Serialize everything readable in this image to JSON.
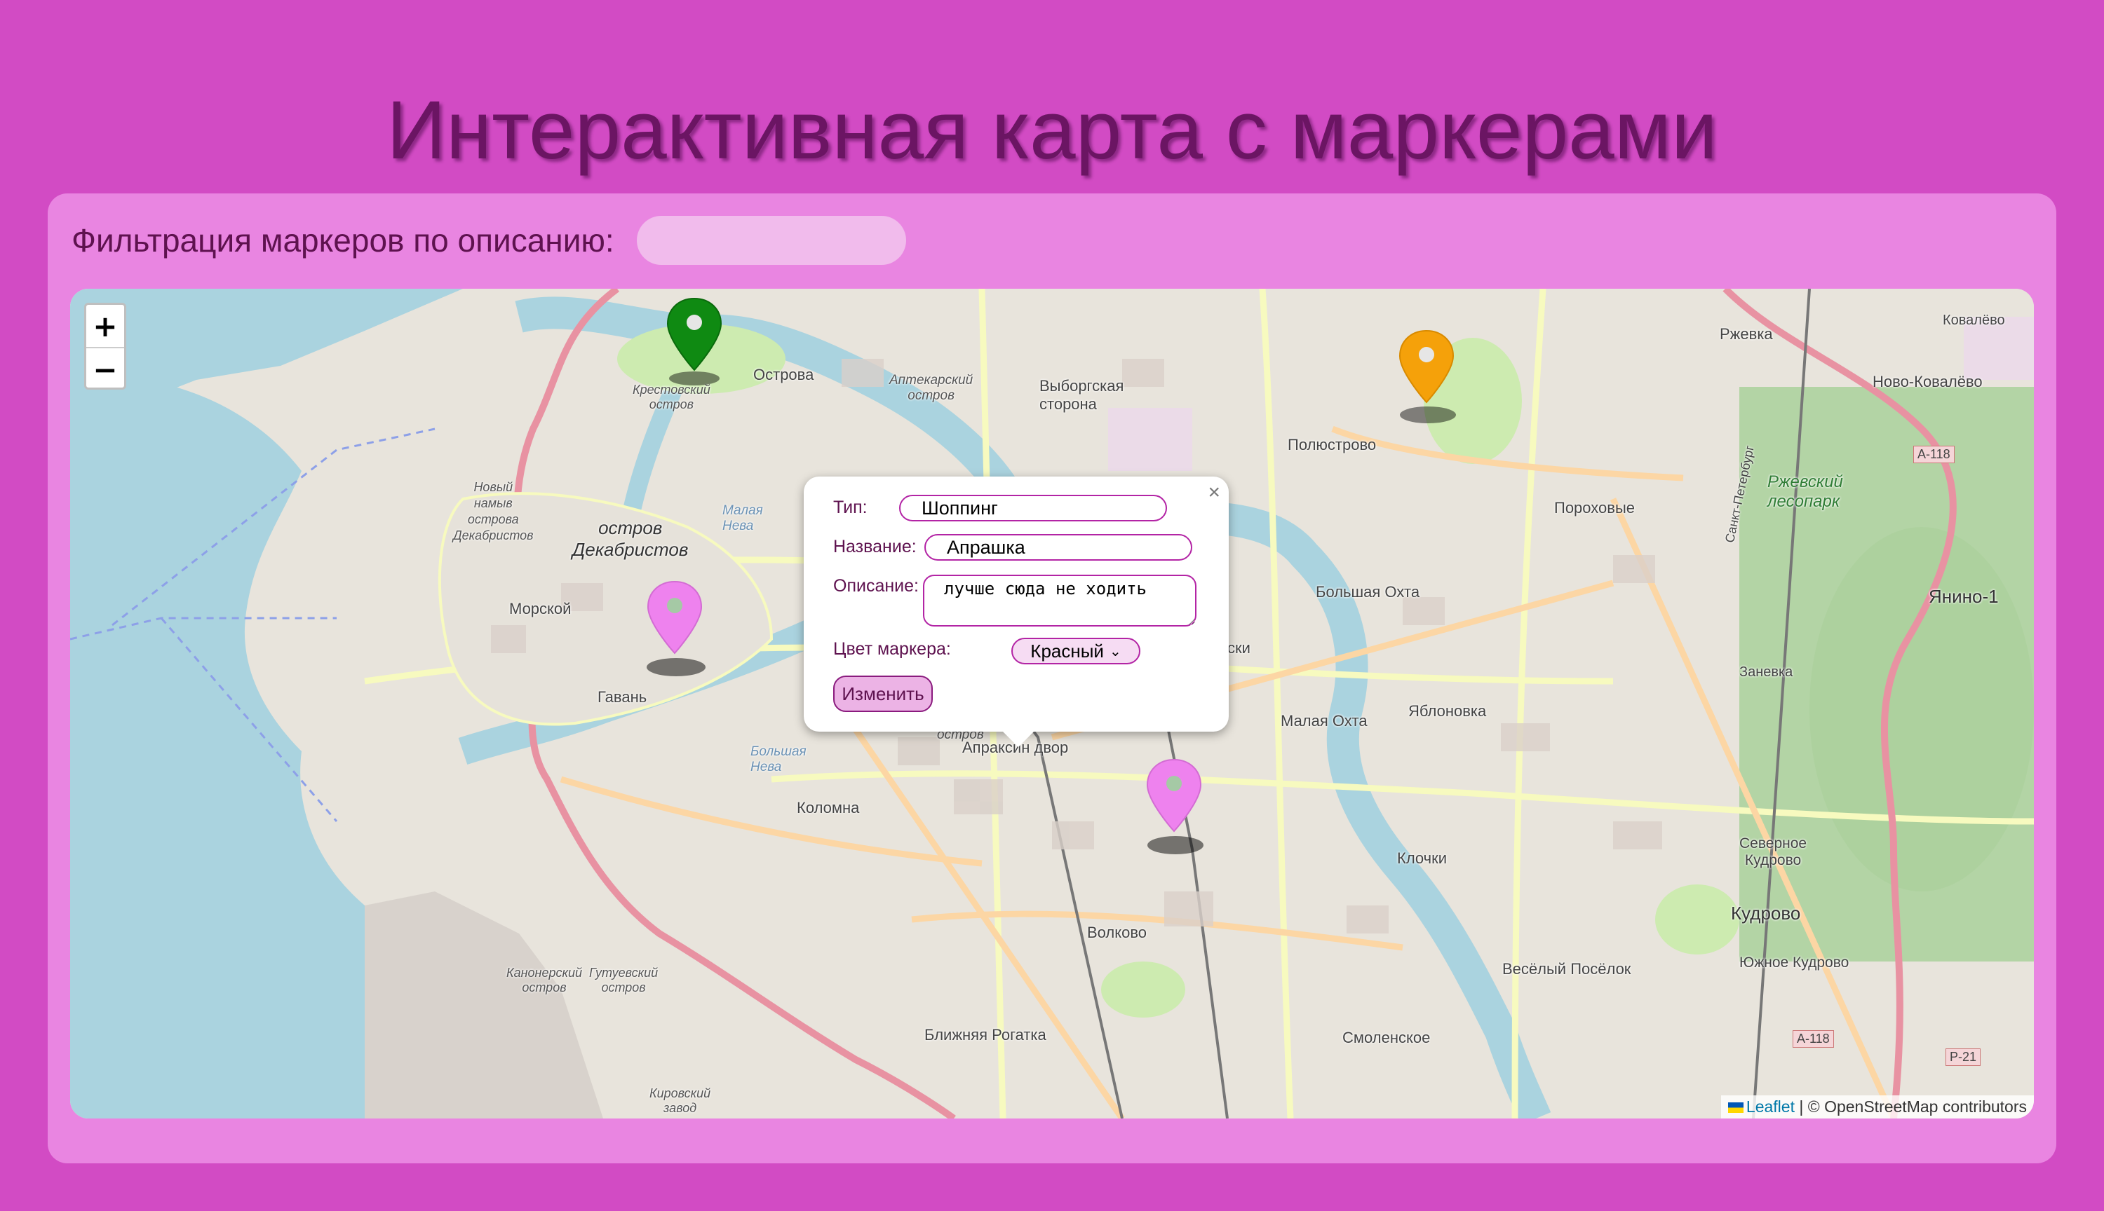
{
  "page": {
    "title": "Интерактивная карта с маркерами"
  },
  "filter": {
    "label": "Фильтрация маркеров по описанию:",
    "value": "",
    "placeholder": ""
  },
  "map": {
    "zoom_in": "+",
    "zoom_out": "−",
    "attribution": {
      "leaflet": "Leaflet",
      "separator": " | ",
      "osm": "© OpenStreetMap contributors"
    },
    "labels": {
      "krestovsky": "Крестовский\nостров",
      "ostrova": "Острова",
      "aptekarsky": "Аптекарский\nостров",
      "vyborgskaya": "Выборгская\nсторона",
      "polyustrovo": "Полюстрово",
      "rzhevka": "Ржевка",
      "kovalevo": "Ковалёво",
      "novo_kovalevo": "Ново-Ковалёво",
      "novye_ostrova": "Новый\nнамыв\nострова\nДекабристов",
      "dekabristov": "остров\nДекабристов",
      "malaya_neva": "Малая\nНева",
      "morskoy": "Морской",
      "gavan": "Гавань",
      "porokhovye": "Пороховые",
      "rzhevsky_lesopark": "Ржевский\nлесопарк",
      "bolshaya_okhta": "Большая Охта",
      "yanino": "Янино-1",
      "zanevka": "Заневка",
      "malaya_okhta": "Малая Охта",
      "yablonovka": "Яблоновка",
      "apraksin": "Апраксин двор",
      "ostrov": "остров",
      "bolshaya_neva": "Большая\nНева",
      "kolomna": "Коломна",
      "klochki": "Клочки",
      "severnoe_kudrovo": "Северное\nКудрово",
      "kudrovo": "Кудрово",
      "yuzhnoe_kudrovo": "Южное Кудрово",
      "volkovo": "Волково",
      "vesyoly": "Весёлый Посёлок",
      "kanonersky": "Канонерский\nостров",
      "gutuevsky": "Гутуевский\nостров",
      "blizhnyaya": "Ближняя Рогатка",
      "smolenskoe": "Смоленское",
      "kirovsky": "Кировский\nзавод",
      "a118_top": "А-118",
      "a118_bottom": "А-118",
      "r21": "Р-21",
      "skaya": "ски",
      "spb_ring": "Санкт-Петербург"
    },
    "markers": [
      {
        "name": "green",
        "color": "#0f8a12"
      },
      {
        "name": "orange",
        "color": "#f5a10a"
      },
      {
        "name": "violet-west",
        "color": "#ee82ee"
      },
      {
        "name": "violet-center",
        "color": "#ee82ee"
      }
    ]
  },
  "popup": {
    "close": "×",
    "type_label": "Тип:",
    "type_value": "Шоппинг",
    "name_label": "Название:",
    "name_value": "Апрашка",
    "desc_label": "Описание:",
    "desc_value": "лучше сюда не ходить",
    "color_label": "Цвет маркера:",
    "color_value": "Красный",
    "submit_label": "Изменить"
  },
  "colors": {
    "background": "#d24bc4",
    "panel": "#e985e1",
    "title": "#6b1563",
    "accent_border": "#b324a5",
    "water": "#aad3df"
  }
}
